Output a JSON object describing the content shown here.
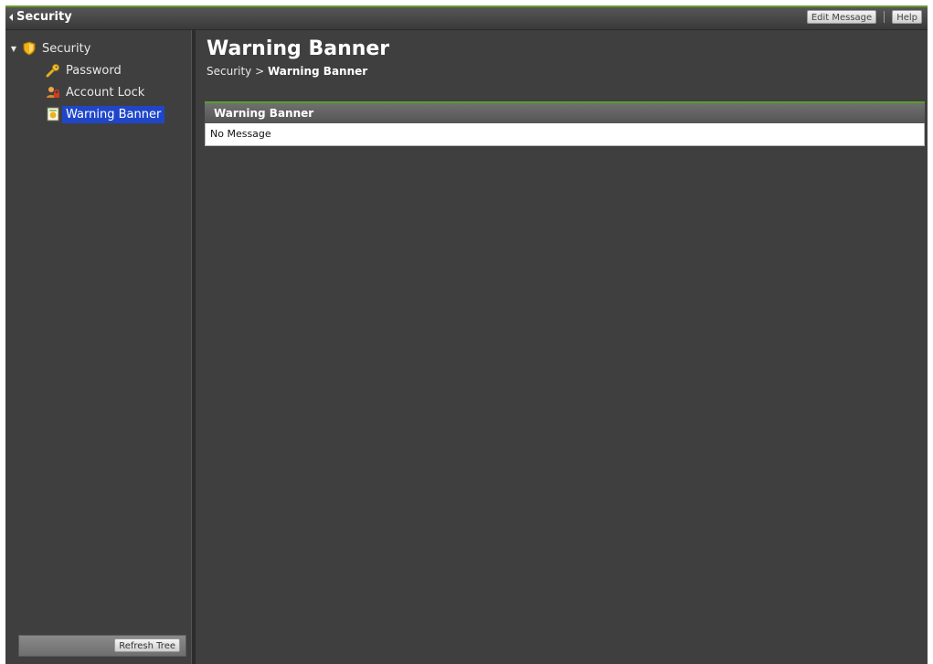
{
  "titlebar": {
    "title": "Security",
    "buttons": {
      "edit_message": "Edit Message",
      "help": "Help"
    }
  },
  "sidebar": {
    "tree": {
      "root": {
        "label": "Security",
        "icon": "security-shield-icon"
      },
      "items": [
        {
          "label": "Password",
          "icon": "key-icon"
        },
        {
          "label": "Account Lock",
          "icon": "user-lock-icon"
        },
        {
          "label": "Warning Banner",
          "icon": "banner-document-icon",
          "selected": true
        }
      ]
    },
    "refresh_label": "Refresh Tree"
  },
  "main": {
    "page_title": "Warning Banner",
    "breadcrumb": {
      "parent": "Security",
      "separator": ">",
      "current": "Warning Banner"
    },
    "panel": {
      "header": "Warning Banner",
      "message": "No Message"
    }
  },
  "colors": {
    "background": "#3f3f3f",
    "accent_green": "#5aa02c",
    "selection_blue": "#1f46c9"
  }
}
